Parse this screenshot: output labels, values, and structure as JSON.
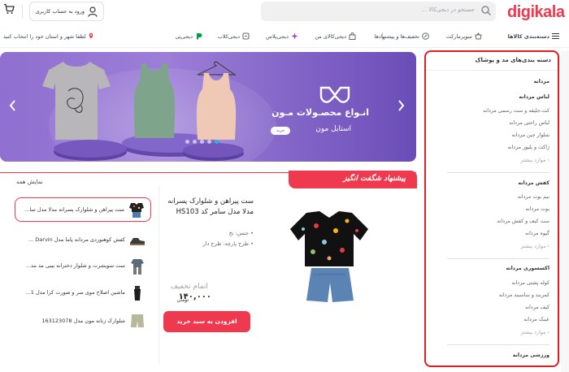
{
  "header": {
    "logo": "digikala",
    "search_placeholder": "جستجو در دیجی‌کالا ...",
    "login_label": "ورود به حساب کاربری"
  },
  "nav": {
    "items": [
      "دسته‌بندی کالاها",
      "سوپرمارکت",
      "تخفیف‌ها و پیشنهادها",
      "دیجی‌کالای من",
      "دیجی‌پلاس",
      "دیجی‌کلاب",
      "دیجی‌پی"
    ],
    "city_prompt": "لطفا شهر و استان خود را انتخاب کنید"
  },
  "banner": {
    "title": "انـواع محصـولات مـون",
    "subtitle": "استایل مون",
    "button": "خرید",
    "active_slide": 1,
    "slide_count": 5
  },
  "offer": {
    "heading": "پیشنهاد شگفت انگیز",
    "view_all": "نمایش همه",
    "items": [
      {
        "name": "ست پیراهن و شلوارک پسرانه مدلا مدل سا..."
      },
      {
        "name": "کفش کوهنوردی مردانه پاما مدل Darvin ..."
      },
      {
        "name": "ست سویشرت و شلوار دخترانه بیبی مد مد..."
      },
      {
        "name": "ماشین اصلاح موی سر و صورت کرا مدل 1..."
      },
      {
        "name": "شلوارک زنانه مون مدل 163123078"
      }
    ],
    "product": {
      "title": "ست پیراهن و شلوارک پسرانه مدلا مدل سامر کد HS103",
      "attr_material": "جنس: نخ",
      "attr_pattern": "طرح پارچه: طرح دار",
      "status": "اتمام تخفیف",
      "price": "۱۴۰,۰۰۰",
      "currency": "تومان",
      "add_to_cart": "افزودن به سبد خرید"
    }
  },
  "sidebar": {
    "title": "دسته بندی‌های مد و پوشاک",
    "section_men": "مردانه",
    "clothing_heading": "لباس مردانه",
    "clothing_items": [
      "کت،جلیقه و ست رسمی مردانه",
      "لباس راحتی مردانه",
      "شلوار جین مردانه",
      "ژاکت و پلیور مردانه"
    ],
    "more1": "موارد بیشتر",
    "shoes_heading": "کفش مردانه",
    "shoes_items": [
      "نیم بوت مردانه",
      "بوت مردانه",
      "ست کیف و کفش مردانه",
      "گیوه مردانه"
    ],
    "more2": "موارد بیشتر",
    "acc_heading": "اکسسوری مردانه",
    "acc_items": [
      "کوله پشتی مردانه",
      "کمربند و ساسبند مردانه",
      "کیف مردانه",
      "عینک مردانه"
    ],
    "more3": "موارد بیشتر",
    "sport_heading": "ورزشی مردانه"
  },
  "colors": {
    "brand": "#ef394e",
    "highlight_border": "#e11d22",
    "banner": "#8f6fcf",
    "dot_active": "#19bfd3"
  }
}
